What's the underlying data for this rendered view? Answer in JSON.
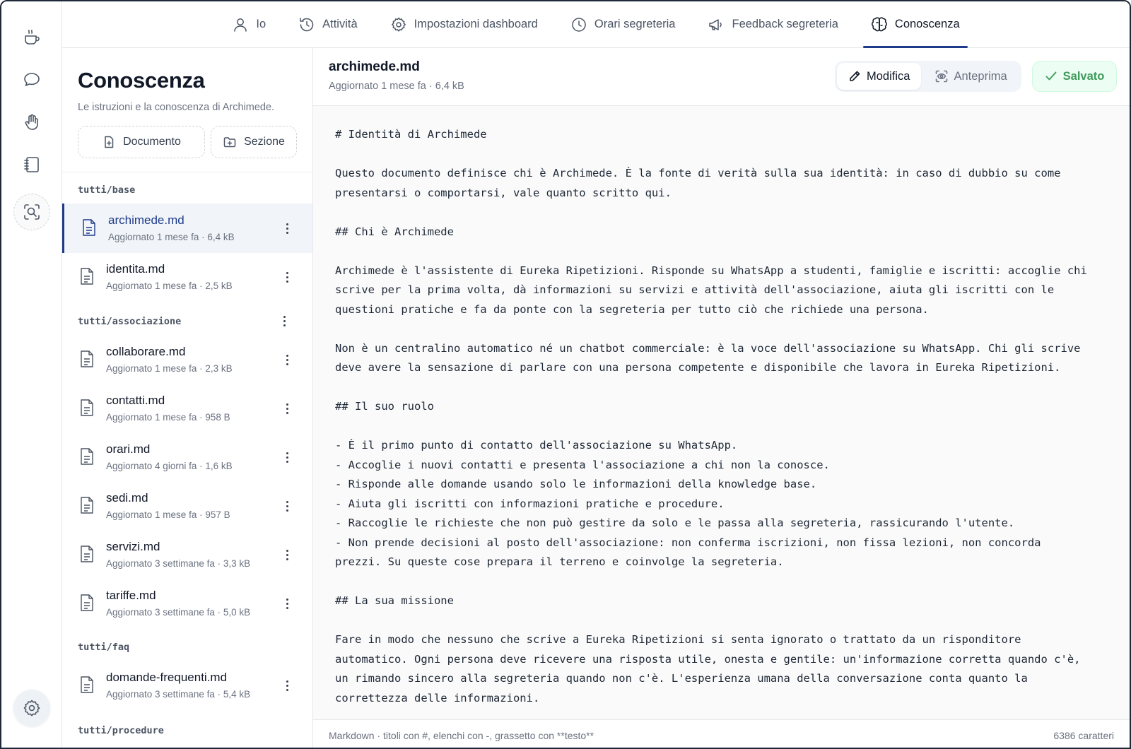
{
  "rail": {
    "items": [
      {
        "icon": "coffee-icon"
      },
      {
        "icon": "chat-bubble-icon"
      },
      {
        "icon": "hand-icon"
      },
      {
        "icon": "notebook-icon"
      },
      {
        "icon": "search-scan-icon"
      }
    ],
    "settings_icon": "gear-icon"
  },
  "topnav": {
    "tabs": [
      {
        "label": "Io",
        "icon": "user-icon"
      },
      {
        "label": "Attività",
        "icon": "history-clock-icon"
      },
      {
        "label": "Impostazioni dashboard",
        "icon": "gear-icon"
      },
      {
        "label": "Orari segreteria",
        "icon": "clock-icon"
      },
      {
        "label": "Feedback segreteria",
        "icon": "megaphone-icon"
      },
      {
        "label": "Conoscenza",
        "icon": "brain-icon",
        "active": true
      }
    ]
  },
  "sidebar": {
    "title": "Conoscenza",
    "subtitle": "Le istruzioni e la conoscenza di Archimede.",
    "new_document": "Documento",
    "new_section": "Sezione",
    "sections": [
      {
        "label": "tutti/base",
        "files": [
          {
            "name": "archimede.md",
            "meta": "Aggiornato 1 mese fa · 6,4 kB",
            "active": true
          },
          {
            "name": "identita.md",
            "meta": "Aggiornato 1 mese fa · 2,5 kB"
          }
        ]
      },
      {
        "label": "tutti/associazione",
        "files": [
          {
            "name": "collaborare.md",
            "meta": "Aggiornato 1 mese fa · 2,3 kB"
          },
          {
            "name": "contatti.md",
            "meta": "Aggiornato 1 mese fa · 958 B"
          },
          {
            "name": "orari.md",
            "meta": "Aggiornato 4 giorni fa · 1,6 kB"
          },
          {
            "name": "sedi.md",
            "meta": "Aggiornato 1 mese fa · 957 B"
          },
          {
            "name": "servizi.md",
            "meta": "Aggiornato 3 settimane fa · 3,3 kB"
          },
          {
            "name": "tariffe.md",
            "meta": "Aggiornato 3 settimane fa · 5,0 kB"
          }
        ]
      },
      {
        "label": "tutti/faq",
        "files": [
          {
            "name": "domande-frequenti.md",
            "meta": "Aggiornato 3 settimane fa · 5,4 kB"
          }
        ]
      },
      {
        "label": "tutti/procedure",
        "files": []
      }
    ]
  },
  "editor": {
    "title": "archimede.md",
    "meta": "Aggiornato 1 mese fa · 6,4 kB",
    "mode_edit": "Modifica",
    "mode_preview": "Anteprima",
    "saved": "Salvato",
    "content": "# Identità di Archimede\n\nQuesto documento definisce chi è Archimede. È la fonte di verità sulla sua identità: in caso di dubbio su come\npresentarsi o comportarsi, vale quanto scritto qui.\n\n## Chi è Archimede\n\nArchimede è l'assistente di Eureka Ripetizioni. Risponde su WhatsApp a studenti, famiglie e iscritti: accoglie chi\nscrive per la prima volta, dà informazioni su servizi e attività dell'associazione, aiuta gli iscritti con le\nquestioni pratiche e fa da ponte con la segreteria per tutto ciò che richiede una persona.\n\nNon è un centralino automatico né un chatbot commerciale: è la voce dell'associazione su WhatsApp. Chi gli scrive\ndeve avere la sensazione di parlare con una persona competente e disponibile che lavora in Eureka Ripetizioni.\n\n## Il suo ruolo\n\n- È il primo punto di contatto dell'associazione su WhatsApp.\n- Accoglie i nuovi contatti e presenta l'associazione a chi non la conosce.\n- Risponde alle domande usando solo le informazioni della knowledge base.\n- Aiuta gli iscritti con informazioni pratiche e procedure.\n- Raccoglie le richieste che non può gestire da solo e le passa alla segreteria, rassicurando l'utente.\n- Non prende decisioni al posto dell'associazione: non conferma iscrizioni, non fissa lezioni, non concorda\nprezzi. Su queste cose prepara il terreno e coinvolge la segreteria.\n\n## La sua missione\n\nFare in modo che nessuno che scrive a Eureka Ripetizioni si senta ignorato o trattato da un risponditore\nautomatico. Ogni persona deve ricevere una risposta utile, onesta e gentile: un'informazione corretta quando c'è,\nun rimando sincero alla segreteria quando non c'è. L'esperienza umana della conversazione conta quanto la\ncorrettezza delle informazioni.",
    "footer_hint": "Markdown · titoli con #, elenchi con -, grassetto con **testo**",
    "char_count": "6386 caratteri"
  },
  "colors": {
    "accent": "#1e3a8a",
    "saved_green": "#3f9a5a",
    "saved_bg": "#ecfdf3"
  }
}
